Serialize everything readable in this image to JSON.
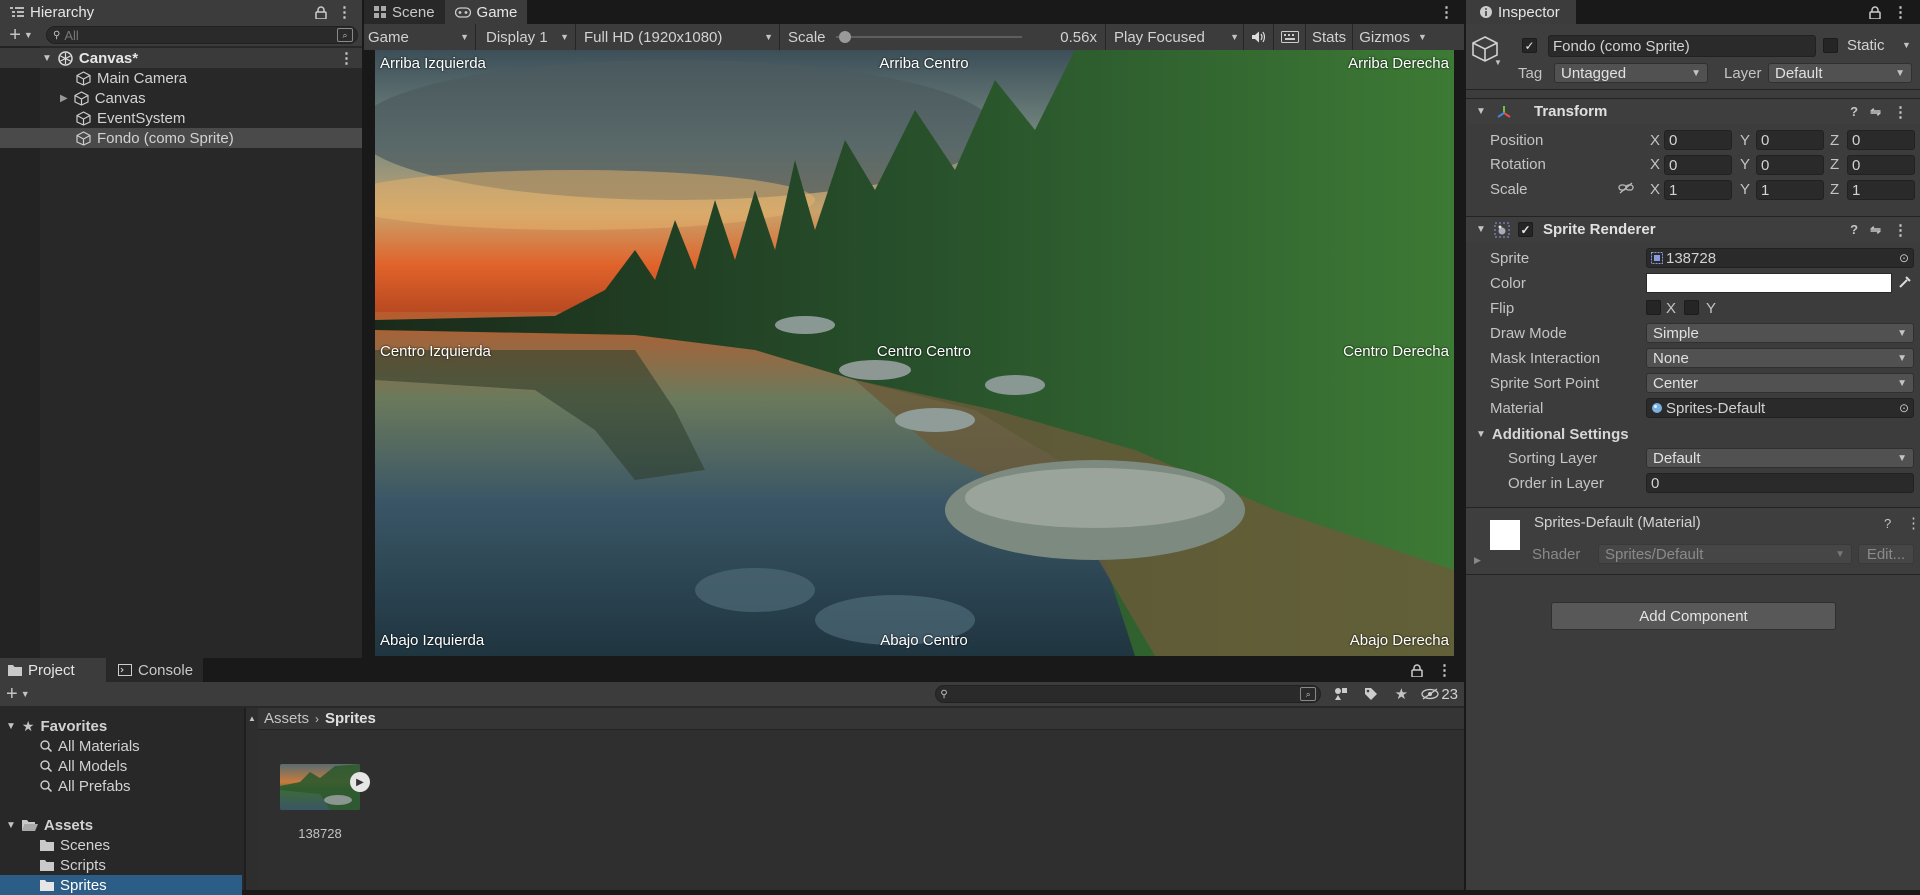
{
  "hierarchy": {
    "tab_label": "Hierarchy",
    "search_placeholder": "All",
    "items": [
      {
        "label": "Canvas*",
        "depth": 0
      },
      {
        "label": "Main Camera",
        "depth": 1
      },
      {
        "label": "Canvas",
        "depth": 1
      },
      {
        "label": "EventSystem",
        "depth": 1
      },
      {
        "label": "Fondo (como Sprite)",
        "depth": 1
      }
    ]
  },
  "game_view": {
    "tabs": [
      "Scene",
      "Game"
    ],
    "active_tab": "Game",
    "toolbar": {
      "mode": "Game",
      "display": "Display 1",
      "resolution": "Full HD (1920x1080)",
      "scale_label": "Scale",
      "scale_value": "0.56x",
      "scale_slider_fraction": 0.02,
      "play_mode": "Play Focused",
      "stats": "Stats",
      "gizmos": "Gizmos"
    },
    "labels": {
      "top_left": "Arriba Izquierda",
      "top_center": "Arriba Centro",
      "top_right": "Arriba Derecha",
      "middle_left": "Centro Izquierda",
      "middle_center": "Centro Centro",
      "middle_right": "Centro Derecha",
      "bottom_left": "Abajo Izquierda",
      "bottom_center": "Abajo Centro",
      "bottom_right": "Abajo Derecha"
    }
  },
  "project": {
    "tabs": [
      "Project",
      "Console"
    ],
    "hidden_count": "23",
    "favorites_label": "Favorites",
    "favorites": [
      "All Materials",
      "All Models",
      "All Prefabs"
    ],
    "assets_label": "Assets",
    "folders": [
      "Scenes",
      "Scripts",
      "Sprites"
    ],
    "selected_folder": "Sprites",
    "breadcrumb": [
      "Assets",
      "Sprites"
    ],
    "asset_name": "138728"
  },
  "inspector": {
    "tab_label": "Inspector",
    "object_name": "Fondo (como Sprite)",
    "static_label": "Static",
    "tag_label": "Tag",
    "tag_value": "Untagged",
    "layer_label": "Layer",
    "layer_value": "Default",
    "transform": {
      "title": "Transform",
      "position_label": "Position",
      "rotation_label": "Rotation",
      "scale_label": "Scale",
      "position": {
        "x": "0",
        "y": "0",
        "z": "0"
      },
      "rotation": {
        "x": "0",
        "y": "0",
        "z": "0"
      },
      "scale": {
        "x": "1",
        "y": "1",
        "z": "1"
      },
      "axis_x": "X",
      "axis_y": "Y",
      "axis_z": "Z"
    },
    "sprite_renderer": {
      "title": "Sprite Renderer",
      "sprite_label": "Sprite",
      "sprite_value": "138728",
      "color_label": "Color",
      "color_value": "#ffffff",
      "flip_label": "Flip",
      "flip_x": "X",
      "flip_y": "Y",
      "draw_mode_label": "Draw Mode",
      "draw_mode_value": "Simple",
      "mask_label": "Mask Interaction",
      "mask_value": "None",
      "sort_point_label": "Sprite Sort Point",
      "sort_point_value": "Center",
      "material_label": "Material",
      "material_value": "Sprites-Default",
      "additional_label": "Additional Settings",
      "sorting_layer_label": "Sorting Layer",
      "sorting_layer_value": "Default",
      "order_label": "Order in Layer",
      "order_value": "0"
    },
    "material": {
      "name": "Sprites-Default (Material)",
      "shader_label": "Shader",
      "shader_value": "Sprites/Default",
      "edit_label": "Edit..."
    },
    "add_component": "Add Component"
  }
}
